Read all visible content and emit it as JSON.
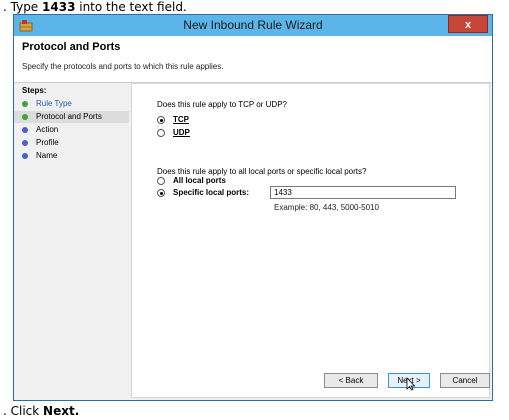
{
  "instructions": {
    "step1_prefix": ". Type ",
    "step1_bold": "1433",
    "step1_suffix": " into the text field.",
    "step2_prefix": ". Click ",
    "step2_bold": "Next."
  },
  "window": {
    "title": "New Inbound Rule Wizard",
    "close_label": "x"
  },
  "header": {
    "title": "Protocol and Ports",
    "subtitle": "Specify the protocols and ports to which this rule applies."
  },
  "steps": {
    "title": "Steps:",
    "items": [
      {
        "label": "Rule Type",
        "dot_color": "#3fa33a"
      },
      {
        "label": "Protocol and Ports",
        "dot_color": "#3fa33a"
      },
      {
        "label": "Action",
        "dot_color": "#4a5fc9"
      },
      {
        "label": "Profile",
        "dot_color": "#4a5fc9"
      },
      {
        "label": "Name",
        "dot_color": "#4a5fc9"
      }
    ],
    "selected_index": 1
  },
  "protocol": {
    "question": "Does this rule apply to TCP or UDP?",
    "tcp_label": "TCP",
    "udp_label": "UDP",
    "selected": "TCP"
  },
  "ports": {
    "question": "Does this rule apply to all local ports or specific local ports?",
    "all_label": "All local ports",
    "specific_label": "Specific local ports:",
    "selected": "specific",
    "value": "1433",
    "example": "Example: 80, 443, 5000-5010"
  },
  "buttons": {
    "back": "< Back",
    "next": "Next >",
    "cancel": "Cancel"
  }
}
